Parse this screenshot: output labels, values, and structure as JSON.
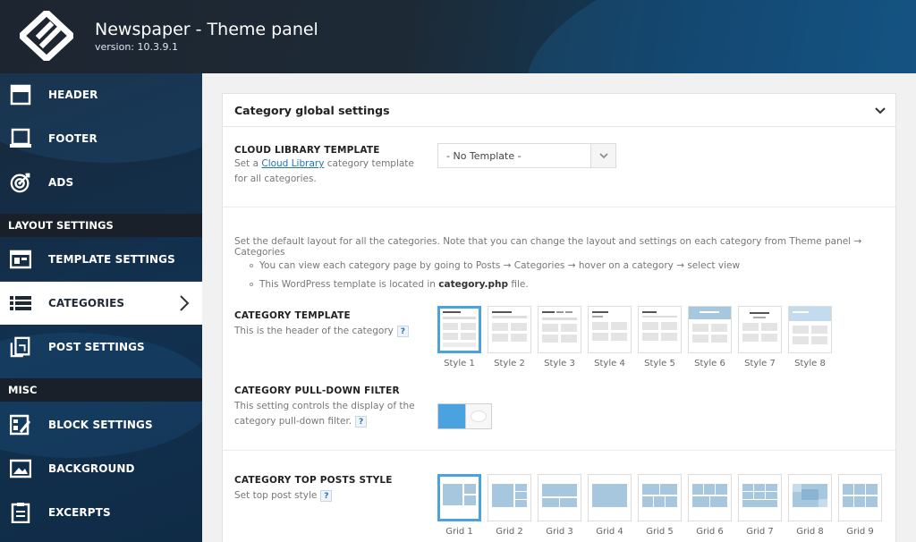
{
  "app": {
    "title": "Newspaper - Theme panel",
    "version": "version: 10.3.9.1",
    "accent_color": "#4aa3df",
    "link_color": "#1f73b7"
  },
  "sidebar": {
    "items": [
      {
        "label": "HEADER",
        "icon": "header-icon"
      },
      {
        "label": "FOOTER",
        "icon": "footer-icon"
      },
      {
        "label": "ADS",
        "icon": "target-icon"
      }
    ],
    "section_layout": "LAYOUT SETTINGS",
    "layout_items": [
      {
        "label": "TEMPLATE SETTINGS",
        "icon": "template-icon"
      },
      {
        "label": "CATEGORIES",
        "icon": "list-icon",
        "active": true
      },
      {
        "label": "POST SETTINGS",
        "icon": "post-icon"
      }
    ],
    "section_misc": "MISC",
    "misc_items": [
      {
        "label": "BLOCK SETTINGS",
        "icon": "block-settings-icon"
      },
      {
        "label": "BACKGROUND",
        "icon": "image-icon"
      },
      {
        "label": "EXCERPTS",
        "icon": "excerpts-icon"
      }
    ]
  },
  "panel": {
    "title": "Category global settings",
    "cloud": {
      "label": "CLOUD LIBRARY TEMPLATE",
      "desc_pre": "Set a ",
      "desc_link": "Cloud Library",
      "desc_post": " category template for all categories.",
      "select_value": "- No Template -"
    },
    "intro": "Set the default layout for all the categories. Note that you can change the layout and settings on each category from Theme panel → Categories",
    "bullet1": "You can view each category page by going to Posts → Categories → hover on a category → select view",
    "bullet2_pre": "This WordPress template is located in ",
    "bullet2_bold": "category.php",
    "bullet2_post": " file.",
    "category_template": {
      "label": "CATEGORY TEMPLATE",
      "desc": "This is the header of the category",
      "help": "?",
      "styles": [
        "Style 1",
        "Style 2",
        "Style 3",
        "Style 4",
        "Style 5",
        "Style 6",
        "Style 7",
        "Style 8"
      ],
      "selected": 0
    },
    "pulldown": {
      "label": "CATEGORY PULL-DOWN FILTER",
      "desc": "This setting controls the display of the category pull-down filter.",
      "help": "?",
      "enabled": true
    },
    "top_posts": {
      "label": "CATEGORY TOP POSTS STYLE",
      "desc": "Set top post style",
      "help": "?",
      "grids": [
        "Grid 1",
        "Grid 2",
        "Grid 3",
        "Grid 4",
        "Grid 5",
        "Grid 6",
        "Grid 7",
        "Grid 8",
        "Grid 9"
      ],
      "selected": 0
    }
  }
}
